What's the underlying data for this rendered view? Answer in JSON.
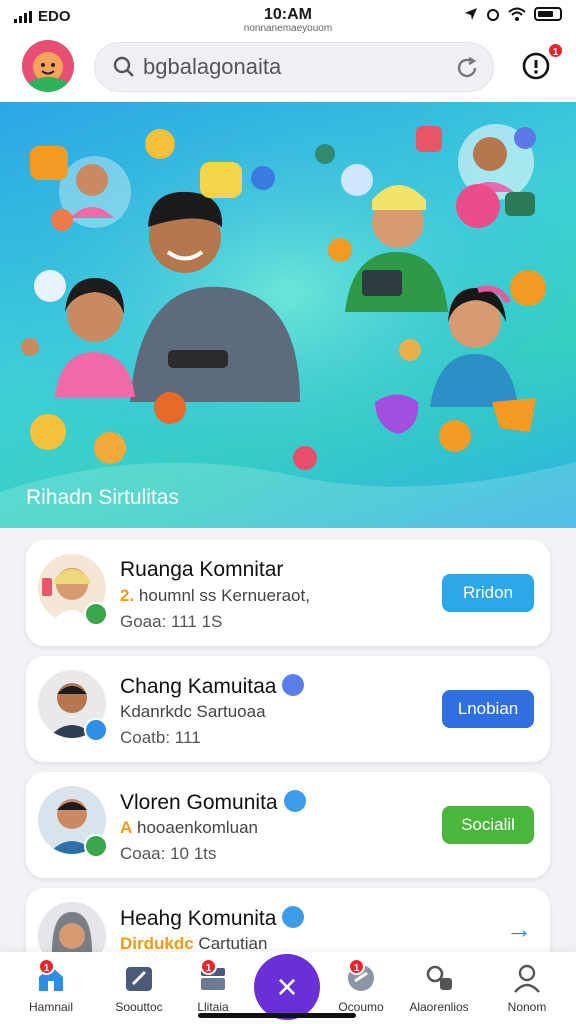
{
  "status_bar": {
    "carrier": "EDO",
    "time": "10:AM",
    "url": "nonnanemaeyouom"
  },
  "header": {
    "search_value": "bgbalagonaita",
    "notification_badge": "1"
  },
  "hero": {
    "title": "Rihadn Sirtulitas"
  },
  "communities": [
    {
      "title": "Ruanga Komnitar",
      "sub_highlight": "2.",
      "sub_text": "houmnl ss Kernueraot,",
      "meta": "Goaa: 111   1S",
      "button_label": "Rridon",
      "button_color": "#2ba8e8",
      "mini_color": "#3aa64a"
    },
    {
      "title": "Chang Kamuitaa",
      "sub_highlight": "",
      "sub_text": "Kdanrkdc Sartuoaa",
      "meta": "Coatb: 111",
      "button_label": "Lnobian",
      "button_color": "#2f6fe0",
      "mini_color": "#2f8fe6",
      "verified_color": "#5a7fe8"
    },
    {
      "title": "Vloren Gomunita",
      "sub_highlight": "A",
      "sub_text": "hooaenkomluan",
      "meta": "Coaa: 10   1ts",
      "button_label": "Socialil",
      "button_color": "#4bb63c",
      "mini_color": "#3aa64a",
      "verified_color": "#3d9be8"
    },
    {
      "title": "Heahg Komunita",
      "sub_highlight": "Dirdukdc",
      "sub_text": "Cartutian",
      "meta": "",
      "button_label": "→",
      "verified_color": "#3d9be8"
    }
  ],
  "bottom_nav": [
    {
      "label": "Hamnail",
      "icon": "home-icon",
      "badge": "1"
    },
    {
      "label": "Soouttoc",
      "icon": "compass-icon",
      "badge": ""
    },
    {
      "label": "Llitaia",
      "icon": "layers-icon",
      "badge": "1"
    },
    {
      "label": "Ocoumo",
      "icon": "chat-icon",
      "badge": "1"
    },
    {
      "label": "Alaorenlios",
      "icon": "group-icon",
      "badge": ""
    },
    {
      "label": "Nonom",
      "icon": "profile-icon",
      "badge": ""
    }
  ],
  "fab": {
    "label": "×"
  },
  "colors": {
    "accent": "#6a2fd6",
    "hero_from": "#2aa6e6",
    "hero_to": "#35d0c0"
  }
}
